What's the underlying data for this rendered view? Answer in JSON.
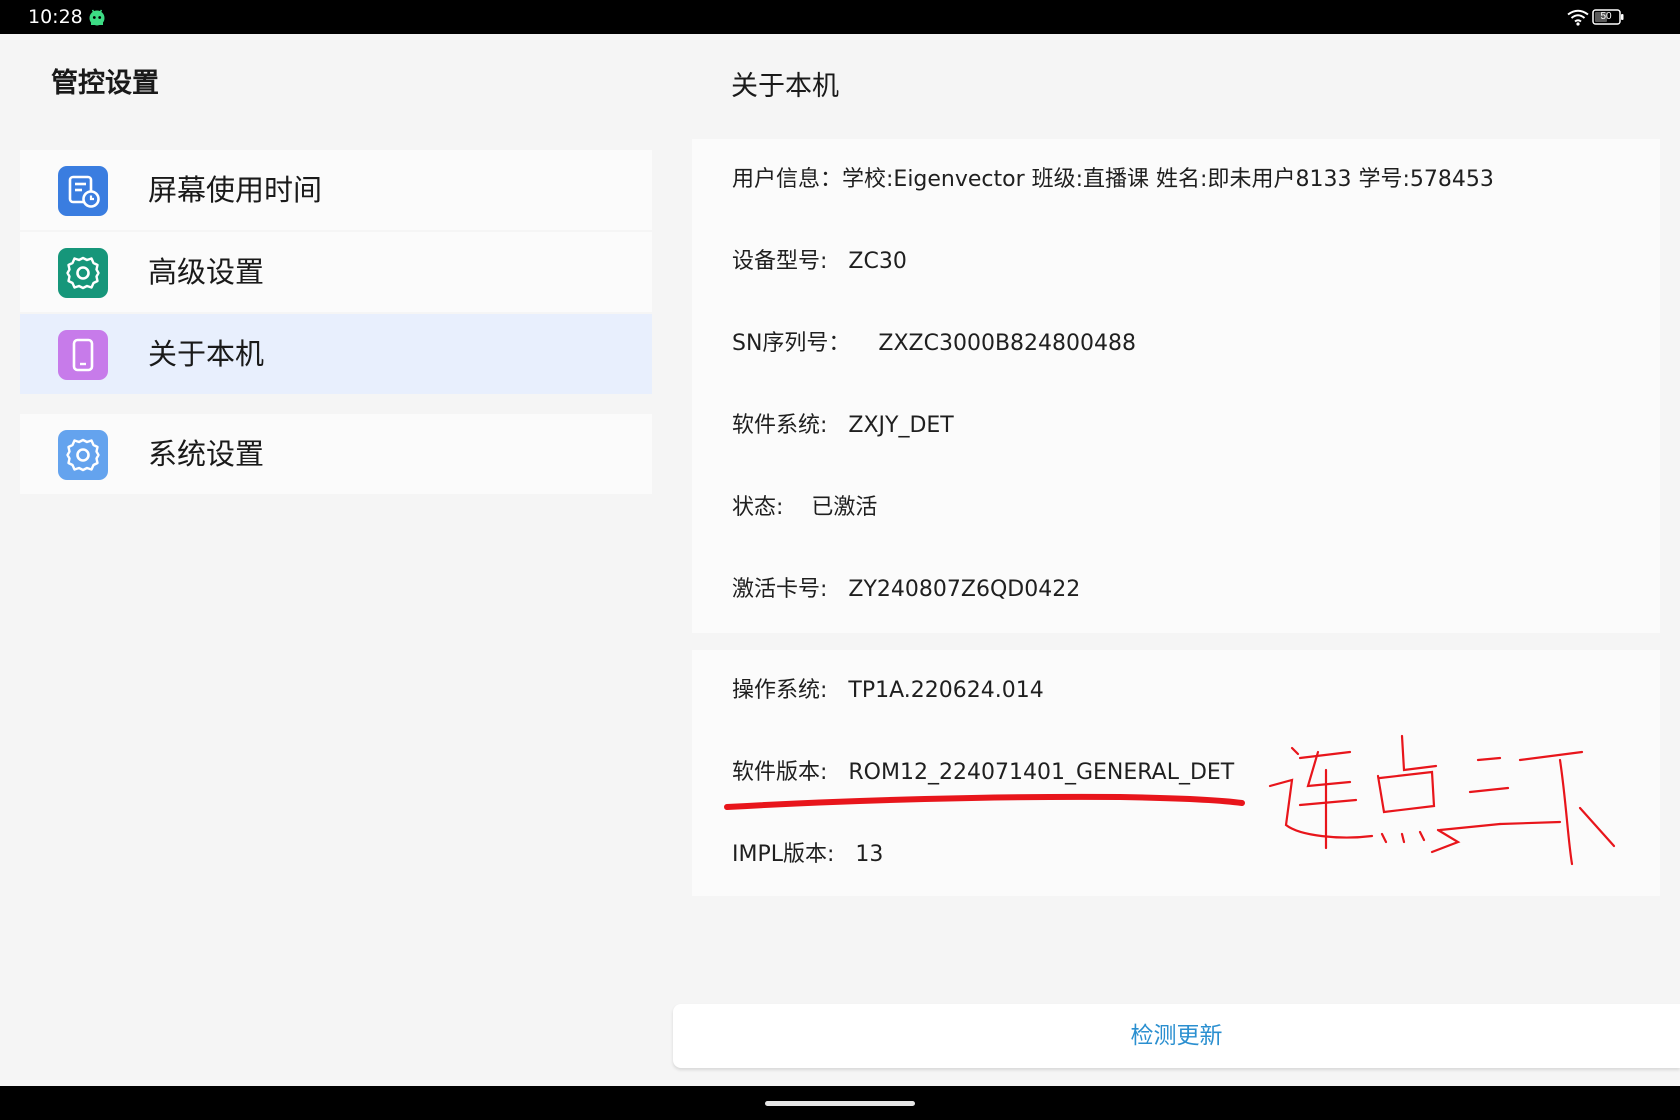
{
  "status_bar": {
    "time": "10:28",
    "app_icon": "android-robot-icon",
    "wifi_icon": "wifi-icon",
    "battery_icon": "battery-icon",
    "battery_level": "50"
  },
  "sidebar": {
    "title": "管控设置",
    "items": [
      {
        "label": "屏幕使用时间",
        "icon": "screen-time-icon",
        "icon_color": "#3a7de0"
      },
      {
        "label": "高级设置",
        "icon": "gear-icon",
        "icon_color": "#16967a"
      },
      {
        "label": "关于本机",
        "icon": "phone-icon",
        "icon_color": "#c77bea",
        "selected": true
      },
      {
        "label": "系统设置",
        "icon": "settings-icon",
        "icon_color": "#64a3ee"
      }
    ]
  },
  "main": {
    "title": "关于本机",
    "device_info": [
      "用户信息：学校:Eigenvector 班级:直播课 姓名:即未用户8133 学号:578453",
      "设备型号:   ZC30",
      "SN序列号：    ZXZC3000B824800488",
      "软件系统:   ZXJY_DET",
      "状态:    已激活",
      "激活卡号:   ZY240807Z6QD0422"
    ],
    "system_info": [
      "操作系统:   TP1A.220624.014",
      "软件版本:   ROM12_224071401_GENERAL_DET",
      "IMPL版本:   13"
    ],
    "check_update_label": "检测更新"
  },
  "annotation": {
    "handwritten_text": "连点三下",
    "color": "#e8151b"
  },
  "colors": {
    "accent": "#2a8fd0",
    "selected_bg": "#e8effd",
    "annotation_red": "#e8151b"
  }
}
